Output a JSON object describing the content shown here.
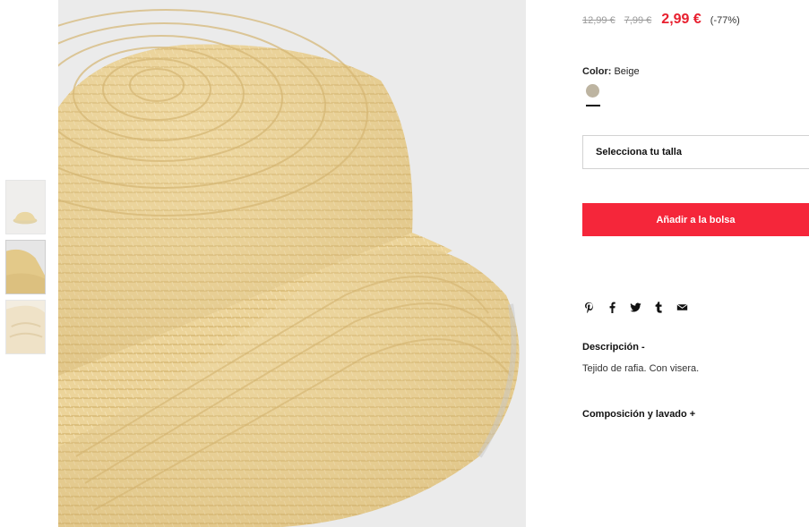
{
  "product": {
    "prices": {
      "original": "12,99 €",
      "previous": "7,99 €",
      "current": "2,99 €",
      "discount": "(-77%)"
    },
    "color": {
      "label": "Color:",
      "value": "Beige",
      "swatch_color": "#bdb4a1"
    },
    "size_select": {
      "placeholder": "Selecciona tu talla"
    },
    "add_to_bag": {
      "label": "Añadir a la bolsa",
      "color": "#f5263a"
    },
    "share_icons": [
      "pinterest-icon",
      "facebook-icon",
      "twitter-icon",
      "tumblr-icon",
      "email-icon"
    ],
    "description": {
      "title": "Descripción -",
      "text": "Tejido de rafia. Con visera."
    },
    "composition": {
      "title": "Composición y lavado +"
    }
  },
  "gallery": {
    "thumbnails": [
      "hat-front-thumb",
      "hat-closeup-thumb",
      "hat-side-thumb"
    ],
    "active_thumbnail": 1
  }
}
